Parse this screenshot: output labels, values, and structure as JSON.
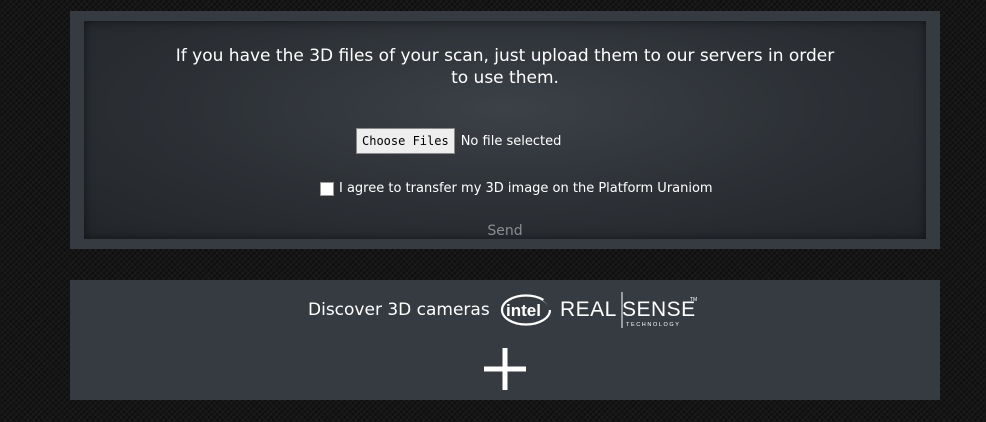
{
  "upload": {
    "intro": "If you have the 3D files of your scan, just upload them to our servers in order to use them.",
    "choose_label": "Choose Files",
    "file_status": "No file selected",
    "agree_label": "I agree to transfer my 3D image on the Platform Uraniom",
    "send_label": "Send"
  },
  "cameras": {
    "discover_text": "Discover 3D cameras",
    "intel_logo_text": "intel",
    "realsense_logo_text": "REALSENSE",
    "realsense_sub_text": "TECHNOLOGY",
    "expand_icon": "plus-icon"
  },
  "colors": {
    "panel": "#363b42",
    "send_disabled": "#8a8d91",
    "text": "#ffffff"
  }
}
